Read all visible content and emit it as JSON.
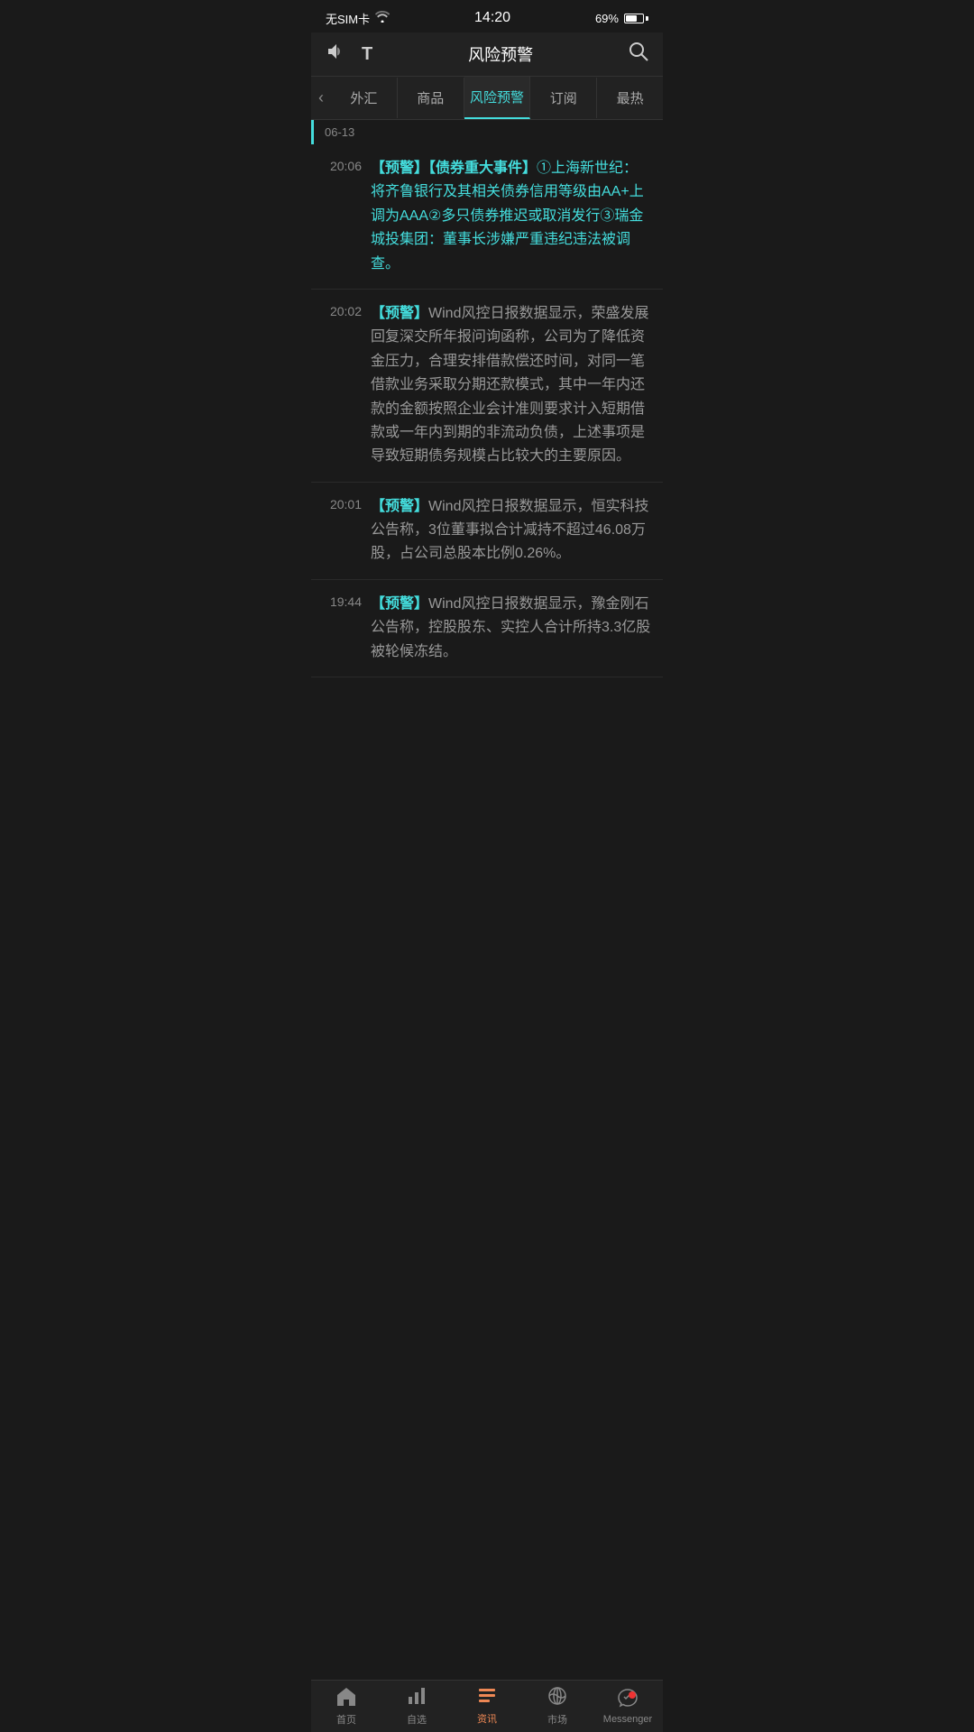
{
  "statusBar": {
    "carrier": "无SIM卡",
    "wifi": "WiFi",
    "time": "14:20",
    "battery": "69%"
  },
  "header": {
    "title": "风险预警",
    "volumeIcon": "🔈",
    "fontIcon": "T",
    "searchIcon": "🔍"
  },
  "tabs": [
    {
      "label": "外汇",
      "active": false
    },
    {
      "label": "商品",
      "active": false
    },
    {
      "label": "风险预警",
      "active": true
    },
    {
      "label": "订阅",
      "active": false
    },
    {
      "label": "最热",
      "active": false
    }
  ],
  "dateDivider": "06-13",
  "newsItems": [
    {
      "time": "20:06",
      "tag": "【预警】【债券重大事件】",
      "content": "①上海新世纪：将齐鲁银行及其相关债券信用等级由AA+上调为AAA②多只债券推迟或取消发行③瑞金城投集团：董事长涉嫌严重违纪违法被调查。",
      "highlighted": true
    },
    {
      "time": "20:02",
      "tag": "【预警】",
      "content": "Wind风控日报数据显示，荣盛发展回复深交所年报问询函称，公司为了降低资金压力，合理安排借款偿还时间，对同一笔借款业务采取分期还款模式，其中一年内还款的金额按照企业会计准则要求计入短期借款或一年内到期的非流动负债，上述事项是导致短期债务规模占比较大的主要原因。",
      "highlighted": false
    },
    {
      "time": "20:01",
      "tag": "【预警】",
      "content": "Wind风控日报数据显示，恒实科技公告称，3位董事拟合计减持不超过46.08万股，占公司总股本比例0.26%。",
      "highlighted": false
    },
    {
      "time": "19:44",
      "tag": "【预警】",
      "content": "Wind风控日报数据显示，豫金刚石公告称，控股股东、实控人合计所持3.3亿股被轮候冻结。",
      "highlighted": false
    }
  ],
  "bottomNav": [
    {
      "icon": "⌂",
      "label": "首页",
      "active": false,
      "name": "home"
    },
    {
      "icon": "📊",
      "label": "自选",
      "active": false,
      "name": "watchlist"
    },
    {
      "icon": "≡",
      "label": "资讯",
      "active": true,
      "name": "news"
    },
    {
      "icon": "🌐",
      "label": "市场",
      "active": false,
      "name": "market"
    },
    {
      "icon": "✦",
      "label": "Messenger",
      "active": false,
      "name": "messenger",
      "badge": true
    }
  ]
}
